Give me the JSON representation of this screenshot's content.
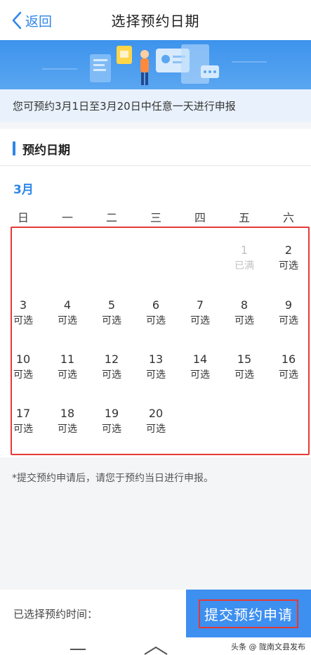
{
  "header": {
    "back_label": "返回",
    "title": "选择预约日期"
  },
  "notice": "您可预约3月1日至3月20日中任意一天进行申报",
  "section": {
    "title": "预约日期"
  },
  "calendar": {
    "month": "3月",
    "weekdays": [
      "日",
      "一",
      "二",
      "三",
      "四",
      "五",
      "六"
    ],
    "days": [
      {
        "num": "1",
        "status": "已满",
        "available": false
      },
      {
        "num": "2",
        "status": "可选",
        "available": true
      },
      {
        "num": "3",
        "status": "可选",
        "available": true
      },
      {
        "num": "4",
        "status": "可选",
        "available": true
      },
      {
        "num": "5",
        "status": "可选",
        "available": true
      },
      {
        "num": "6",
        "status": "可选",
        "available": true
      },
      {
        "num": "7",
        "status": "可选",
        "available": true
      },
      {
        "num": "8",
        "status": "可选",
        "available": true
      },
      {
        "num": "9",
        "status": "可选",
        "available": true
      },
      {
        "num": "10",
        "status": "可选",
        "available": true
      },
      {
        "num": "11",
        "status": "可选",
        "available": true
      },
      {
        "num": "12",
        "status": "可选",
        "available": true
      },
      {
        "num": "13",
        "status": "可选",
        "available": true
      },
      {
        "num": "14",
        "status": "可选",
        "available": true
      },
      {
        "num": "15",
        "status": "可选",
        "available": true
      },
      {
        "num": "16",
        "status": "可选",
        "available": true
      },
      {
        "num": "17",
        "status": "可选",
        "available": true
      },
      {
        "num": "18",
        "status": "可选",
        "available": true
      },
      {
        "num": "19",
        "status": "可选",
        "available": true
      },
      {
        "num": "20",
        "status": "可选",
        "available": true
      }
    ]
  },
  "tip": "*提交预约申请后，请您于预约当日进行申报。",
  "footer": {
    "selected_label": "已选择预约时间：",
    "submit_label": "提交预约申请"
  },
  "watermark": "头条 @ 陇南文县发布",
  "colors": {
    "accent": "#2f86e8",
    "button": "#3d8ff0",
    "highlight_border": "#e53935",
    "full_day": "#c2c2c2"
  }
}
